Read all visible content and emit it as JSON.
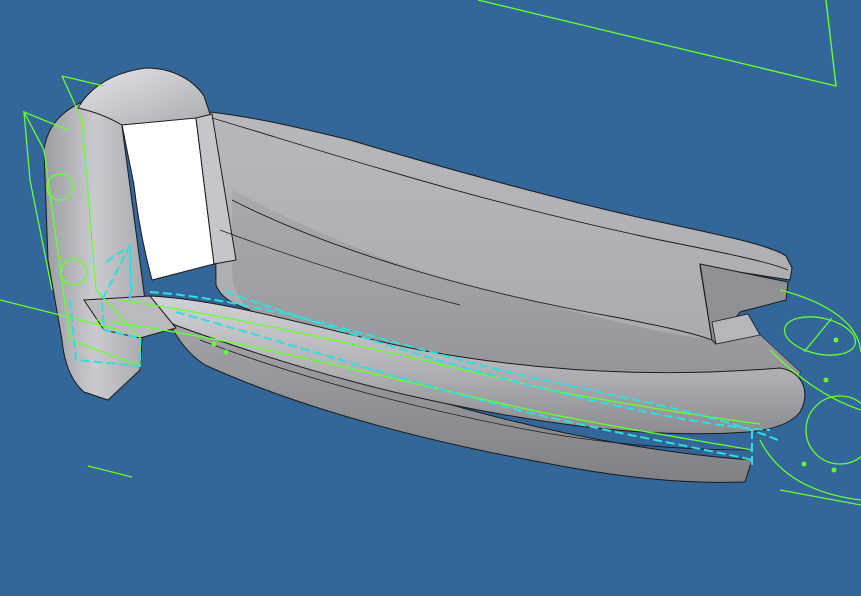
{
  "colors": {
    "background": "#336699",
    "geometry_green": "#66ff33",
    "edge_cyan": "#33dddd",
    "body_light": "#c2c4c8",
    "body_mid": "#a2a4a8",
    "body_dark": "#808286",
    "face_white": "#ffffff",
    "outline": "#1a1a1a"
  },
  "viewport": {
    "view_mode": "shaded-with-edges",
    "visible_part": "3d-part-body",
    "overlays": [
      "sketch-wireframe",
      "selected-edge-loop",
      "reference-plane"
    ]
  }
}
